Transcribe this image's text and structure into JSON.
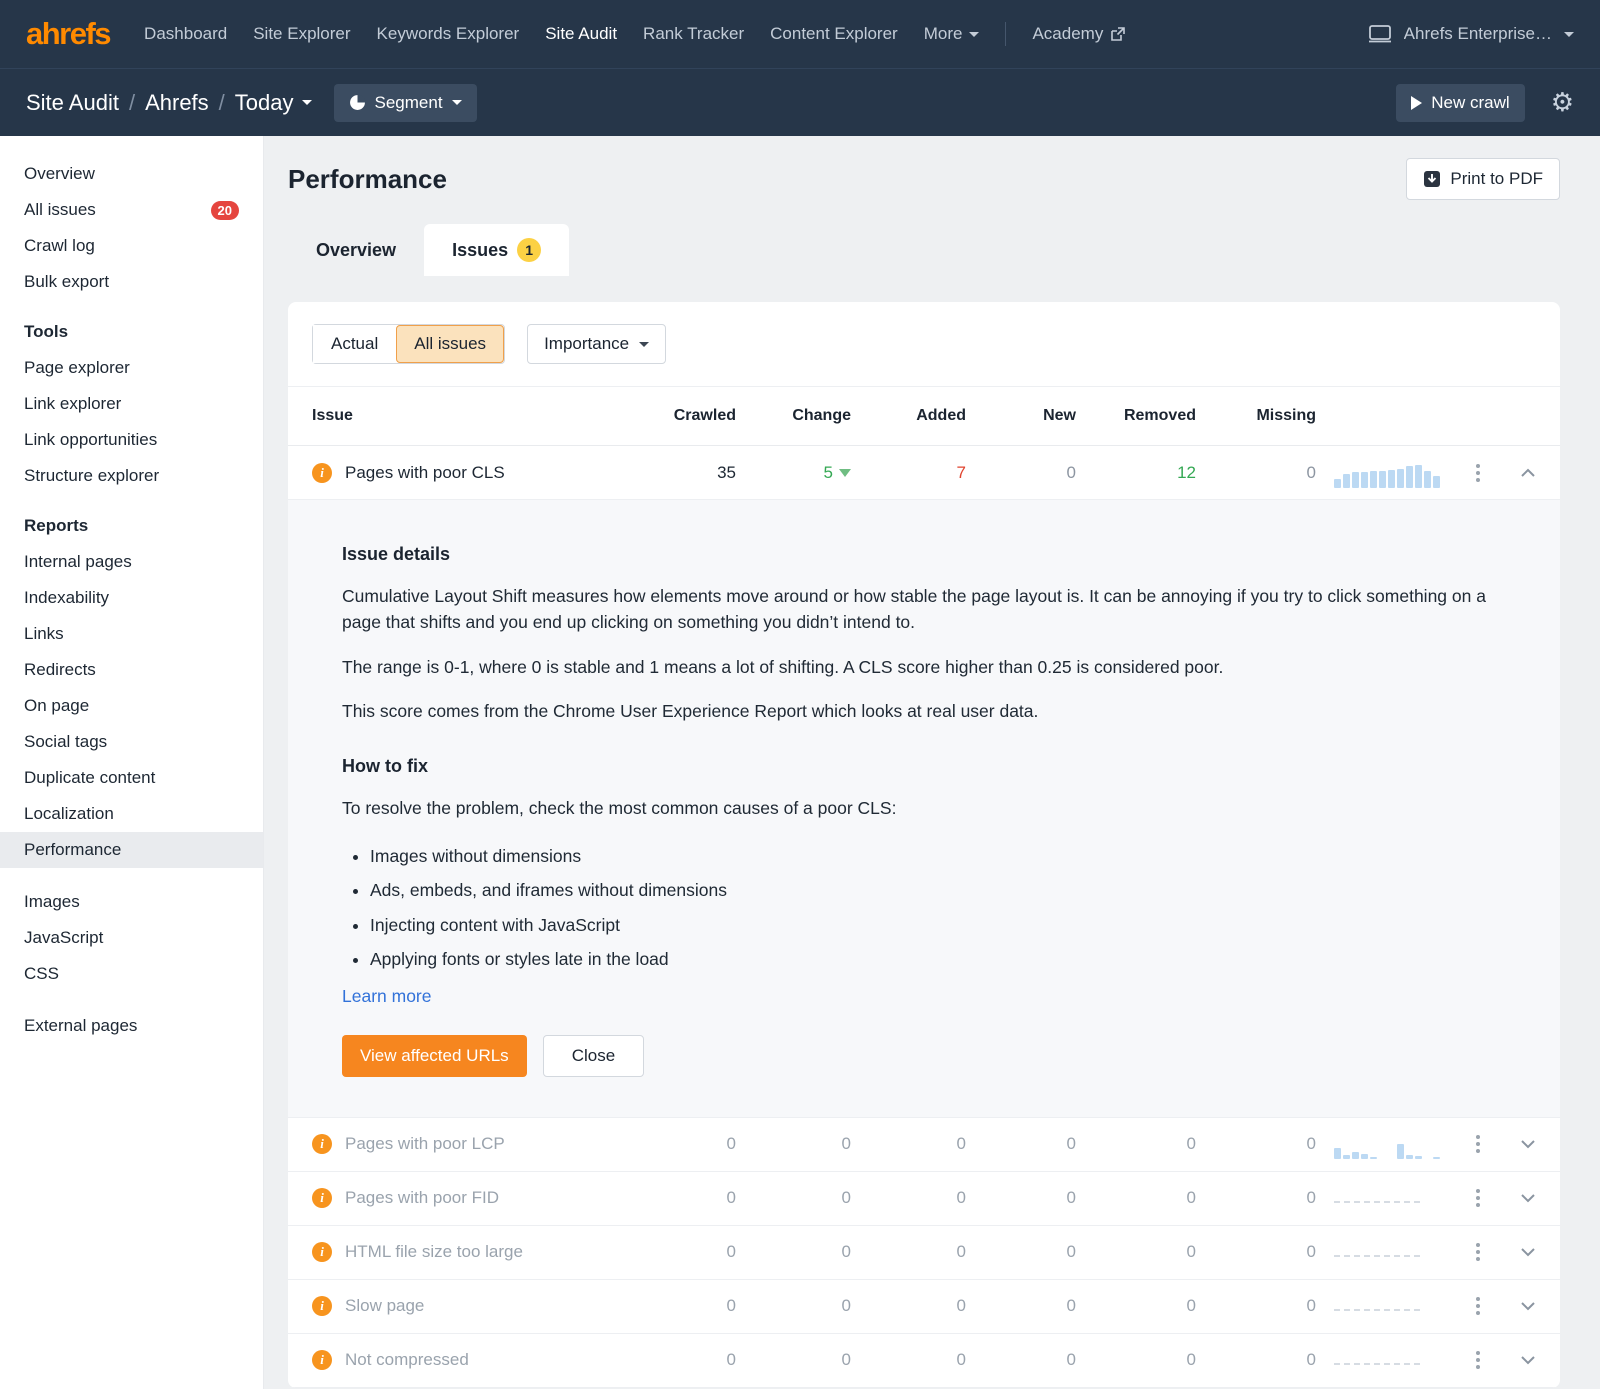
{
  "colors": {
    "nav_bg": "#263649",
    "accent_orange": "#f6861f",
    "logo_orange": "#ff8a00",
    "badge_red": "#e5453f",
    "badge_yellow": "#fcd144",
    "green": "#34a853",
    "red": "#e0442f",
    "spark_blue": "#bcd9f3",
    "link_blue": "#3272d9"
  },
  "topnav": {
    "logo": "ahrefs",
    "items": [
      "Dashboard",
      "Site Explorer",
      "Keywords Explorer",
      "Site Audit",
      "Rank Tracker",
      "Content Explorer",
      "More"
    ],
    "active_item": "Site Audit",
    "academy": "Academy",
    "account": "Ahrefs Enterprise…"
  },
  "subheader": {
    "breadcrumb": [
      "Site Audit",
      "Ahrefs",
      "Today"
    ],
    "separator": "/",
    "segment_label": "Segment",
    "new_crawl_label": "New crawl"
  },
  "sidebar": {
    "groups": [
      {
        "items": [
          {
            "label": "Overview"
          },
          {
            "label": "All issues",
            "badge": "20"
          },
          {
            "label": "Crawl log"
          },
          {
            "label": "Bulk export"
          }
        ]
      },
      {
        "title": "Tools",
        "items": [
          {
            "label": "Page explorer"
          },
          {
            "label": "Link explorer"
          },
          {
            "label": "Link opportunities"
          },
          {
            "label": "Structure explorer"
          }
        ]
      },
      {
        "title": "Reports",
        "items": [
          {
            "label": "Internal pages"
          },
          {
            "label": "Indexability"
          },
          {
            "label": "Links"
          },
          {
            "label": "Redirects"
          },
          {
            "label": "On page"
          },
          {
            "label": "Social tags"
          },
          {
            "label": "Duplicate content"
          },
          {
            "label": "Localization"
          },
          {
            "label": "Performance",
            "active": true
          }
        ]
      },
      {
        "items": [
          {
            "label": "Images"
          },
          {
            "label": "JavaScript"
          },
          {
            "label": "CSS"
          }
        ]
      },
      {
        "items": [
          {
            "label": "External pages"
          }
        ]
      }
    ]
  },
  "main": {
    "title": "Performance",
    "print_button": "Print to PDF",
    "tabs": [
      {
        "label": "Overview"
      },
      {
        "label": "Issues",
        "badge": "1",
        "active": true
      }
    ],
    "filters": {
      "segments": [
        "Actual",
        "All issues"
      ],
      "selected_segment": "All issues",
      "importance_label": "Importance"
    },
    "table": {
      "headers": [
        "Issue",
        "Crawled",
        "Change",
        "Added",
        "New",
        "Removed",
        "Missing"
      ],
      "rows": [
        {
          "issue": "Pages with poor CLS",
          "crawled": "35",
          "change": "5",
          "change_direction": "down",
          "added": "7",
          "new": "0",
          "removed": "12",
          "missing": "0",
          "expanded": true,
          "spark": [
            9,
            14,
            16,
            16,
            17,
            17,
            18,
            19,
            22,
            23,
            17,
            12
          ]
        },
        {
          "issue": "Pages with poor LCP",
          "crawled": "0",
          "change": "0",
          "added": "0",
          "new": "0",
          "removed": "0",
          "missing": "0",
          "spark": [
            11,
            4,
            7,
            5,
            2,
            0,
            0,
            15,
            4,
            3,
            0,
            2
          ]
        },
        {
          "issue": "Pages with poor FID",
          "crawled": "0",
          "change": "0",
          "added": "0",
          "new": "0",
          "removed": "0",
          "missing": "0",
          "spark_type": "dash"
        },
        {
          "issue": "HTML file size too large",
          "crawled": "0",
          "change": "0",
          "added": "0",
          "new": "0",
          "removed": "0",
          "missing": "0",
          "spark_type": "dash"
        },
        {
          "issue": "Slow page",
          "crawled": "0",
          "change": "0",
          "added": "0",
          "new": "0",
          "removed": "0",
          "missing": "0",
          "spark_type": "dash"
        },
        {
          "issue": "Not compressed",
          "crawled": "0",
          "change": "0",
          "added": "0",
          "new": "0",
          "removed": "0",
          "missing": "0",
          "spark_type": "dash"
        }
      ]
    },
    "details": {
      "issue_details_title": "Issue details",
      "paragraph_1": "Cumulative Layout Shift measures how elements move around or how stable the page layout is. It can be annoying if you try to click something on a page that shifts and you end up clicking on something you didn’t intend to.",
      "paragraph_2": "The range is 0-1, where 0 is stable and 1 means a lot of shifting. A CLS score higher than 0.25 is considered poor.",
      "paragraph_3": "This score comes from the Chrome User Experience Report which looks at real user data.",
      "how_to_fix_title": "How to fix",
      "fix_intro": "To resolve the problem, check the most common causes of a poor CLS:",
      "fix_bullets": [
        "Images without dimensions",
        "Ads, embeds, and iframes without dimensions",
        "Injecting content with JavaScript",
        "Applying fonts or styles late in the load"
      ],
      "learn_more_label": "Learn more",
      "view_urls_button": "View affected URLs",
      "close_button": "Close"
    }
  }
}
